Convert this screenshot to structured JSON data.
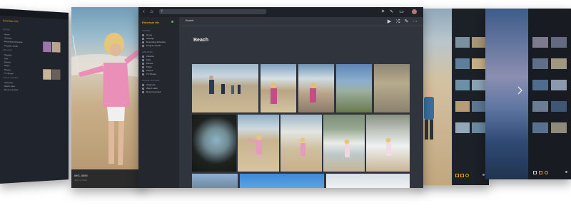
{
  "main": {
    "server_name": "Entertain Me",
    "breadcrumb": "Beach",
    "title": "Beach",
    "sidebar_sections": [
      {
        "heading": "SERVER",
        "items": [
          "Home",
          "Settings",
          "Recording Schedule",
          "Program Guide"
        ]
      },
      {
        "heading": "LIBRARIES",
        "items": [
          "Playlists",
          "Kids",
          "Movies",
          "Music",
          "Photos",
          "TV Shows"
        ]
      },
      {
        "heading": "ONLINE CONTENT",
        "items": [
          "Channels",
          "Watch Later",
          "Recommended"
        ]
      }
    ],
    "toolbar": {
      "play_icon": "play-icon",
      "shuffle_icon": "shuffle-icon",
      "edit_icon": "pencil-icon",
      "more_icon": "more-icon"
    },
    "header_icons": [
      "back-icon",
      "home-icon",
      "search-icon",
      "tools-icon",
      "activity-icon",
      "cast-icon",
      "user-avatar-icon"
    ]
  },
  "left_window": {
    "server_name": "Entertain Me",
    "items": [
      "Home",
      "Settings",
      "Recording Schedule",
      "Program Guide",
      "Playlists",
      "Kids",
      "Movies",
      "Music",
      "Photos",
      "TV Shows",
      "Channels",
      "Watch Later",
      "Recommended"
    ],
    "headings": [
      "SERVER",
      "LIBRARIES",
      "ONLINE CONTENT"
    ]
  },
  "girl_card": {
    "caption": "IMG_0865",
    "date": "July 12, 2012"
  },
  "colors": {
    "accent": "#e5a00d",
    "sidebar_bg": "#24272d",
    "content_bg": "#30343c",
    "topbar_bg": "#1e2127"
  }
}
